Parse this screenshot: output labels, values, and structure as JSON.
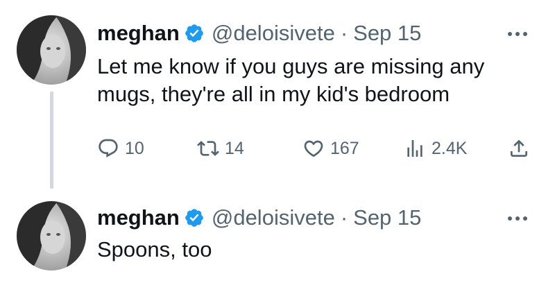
{
  "tweets": [
    {
      "author": {
        "name": "meghan",
        "handle": "@deloisivete",
        "verified": true
      },
      "separator": "·",
      "date": "Sep 15",
      "text_lines": [
        "Let me know if you guys are missing any",
        "mugs, they're all in my kid's bedroom"
      ],
      "stats": {
        "replies": "10",
        "retweets": "14",
        "likes": "167",
        "views": "2.4K"
      }
    },
    {
      "author": {
        "name": "meghan",
        "handle": "@deloisivete",
        "verified": true
      },
      "separator": "·",
      "date": "Sep 15",
      "text_lines": [
        "Spoons, too"
      ]
    }
  ],
  "icons": {
    "verified": "verified-badge-icon",
    "more": "more-options-icon",
    "reply": "reply-icon",
    "retweet": "retweet-icon",
    "like": "heart-icon",
    "views": "views-icon",
    "share": "share-icon"
  },
  "colors": {
    "text": "#0f1419",
    "secondary": "#536471",
    "verified": "#1d9bf0",
    "thread_line": "#cfd9de"
  }
}
